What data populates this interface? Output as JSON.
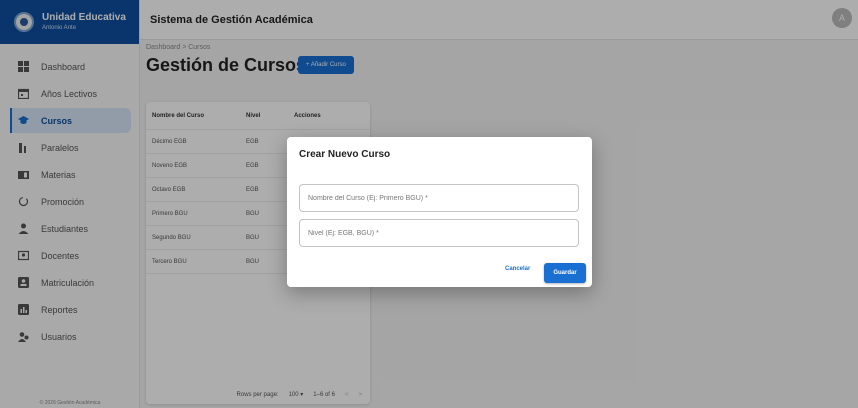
{
  "brand": {
    "title": "Unidad Educativa",
    "subtitle": "Antonio Ante"
  },
  "topbar": {
    "title": "Sistema de Gestión Académica",
    "avatar": "A"
  },
  "sidebar": {
    "items": [
      {
        "label": "Dashboard",
        "icon": "dashboard-icon"
      },
      {
        "label": "Años Lectivos",
        "icon": "calendar-icon"
      },
      {
        "label": "Cursos",
        "icon": "school-icon",
        "active": true
      },
      {
        "label": "Paralelos",
        "icon": "bars-icon"
      },
      {
        "label": "Materias",
        "icon": "book-icon"
      },
      {
        "label": "Promoción",
        "icon": "refresh-icon"
      },
      {
        "label": "Estudiantes",
        "icon": "person-icon"
      },
      {
        "label": "Docentes",
        "icon": "contact-icon"
      },
      {
        "label": "Matriculación",
        "icon": "badge-icon"
      },
      {
        "label": "Reportes",
        "icon": "report-icon"
      },
      {
        "label": "Usuarios",
        "icon": "users-icon"
      }
    ],
    "footer": "© 2026 Gestión Académica"
  },
  "main": {
    "breadcrumb": "Dashboard  >  Cursos",
    "title": "Gestión de Cursos",
    "add_button": "+  Añadir Curso",
    "table": {
      "headers": [
        "Nombre del Curso",
        "Nivel",
        "Acciones"
      ],
      "rows": [
        [
          "Décimo EGB",
          "EGB"
        ],
        [
          "Noveno EGB",
          "EGB"
        ],
        [
          "Octavo EGB",
          "EGB"
        ],
        [
          "Primero BGU",
          "BGU"
        ],
        [
          "Segundo BGU",
          "BGU"
        ],
        [
          "Tercero BGU",
          "BGU"
        ]
      ],
      "pager": {
        "rows_label": "Rows per page:",
        "rows_value": "100 ▾",
        "range": "1–6 of 6"
      }
    }
  },
  "dialog": {
    "title": "Crear Nuevo Curso",
    "name_placeholder": "Nombre del Curso (Ej: Primero BGU) *",
    "level_placeholder": "Nivel (Ej: EGB, BGU) *",
    "cancel": "Cancelar",
    "save": "Guardar"
  },
  "colors": {
    "primary": "#1a6fd3",
    "brand": "#0e4fa0"
  }
}
